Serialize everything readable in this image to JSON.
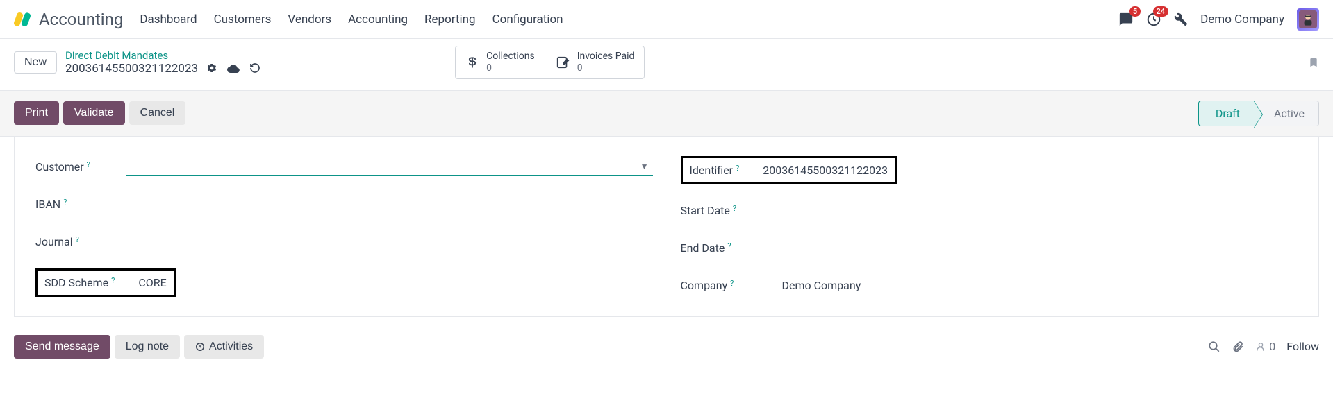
{
  "brand": {
    "title": "Accounting"
  },
  "nav": {
    "items": [
      "Dashboard",
      "Customers",
      "Vendors",
      "Accounting",
      "Reporting",
      "Configuration"
    ]
  },
  "notifications": {
    "messages_count": "5",
    "activities_count": "24"
  },
  "company_name": "Demo Company",
  "breadcrumb": {
    "new_btn": "New",
    "link": "Direct Debit Mandates",
    "current": "20036145500321122023"
  },
  "stats": {
    "collections": {
      "label": "Collections",
      "value": "0"
    },
    "invoices_paid": {
      "label": "Invoices Paid",
      "value": "0"
    }
  },
  "actions": {
    "print": "Print",
    "validate": "Validate",
    "cancel": "Cancel"
  },
  "status": {
    "draft": "Draft",
    "active": "Active"
  },
  "form": {
    "customer_label": "Customer",
    "customer_value": "",
    "iban_label": "IBAN",
    "journal_label": "Journal",
    "sdd_scheme_label": "SDD Scheme",
    "sdd_scheme_value": "CORE",
    "identifier_label": "Identifier",
    "identifier_value": "20036145500321122023",
    "start_date_label": "Start Date",
    "end_date_label": "End Date",
    "company_label": "Company",
    "company_value": "Demo Company"
  },
  "chatter": {
    "send_message": "Send message",
    "log_note": "Log note",
    "activities": "Activities",
    "followers": "0",
    "follow": "Follow"
  }
}
